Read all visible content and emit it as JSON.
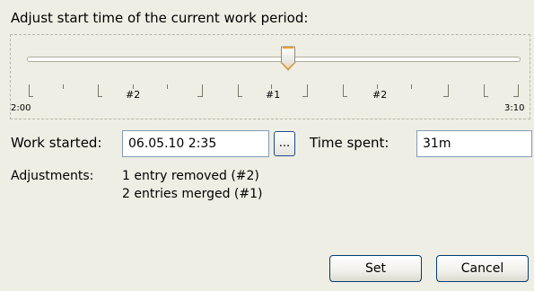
{
  "heading": "Adjust start time of the current work period:",
  "slider": {
    "min_label": "2:00",
    "max_label": "3:10",
    "markers": [
      {
        "label": "#2"
      },
      {
        "label": "#1"
      },
      {
        "label": "#2"
      }
    ]
  },
  "work_started": {
    "label": "Work started:",
    "value": "06.05.10 2:35",
    "ellipsis": "..."
  },
  "time_spent": {
    "label": "Time spent:",
    "value": "31m"
  },
  "adjustments": {
    "label": "Adjustments:",
    "lines": [
      "1 entry removed (#2)",
      "2 entries merged (#1)"
    ]
  },
  "buttons": {
    "set": "Set",
    "cancel": "Cancel"
  },
  "colors": {
    "background": "#efeee4",
    "button_border": "#003c74",
    "thumb_accent": "#f0a030"
  }
}
